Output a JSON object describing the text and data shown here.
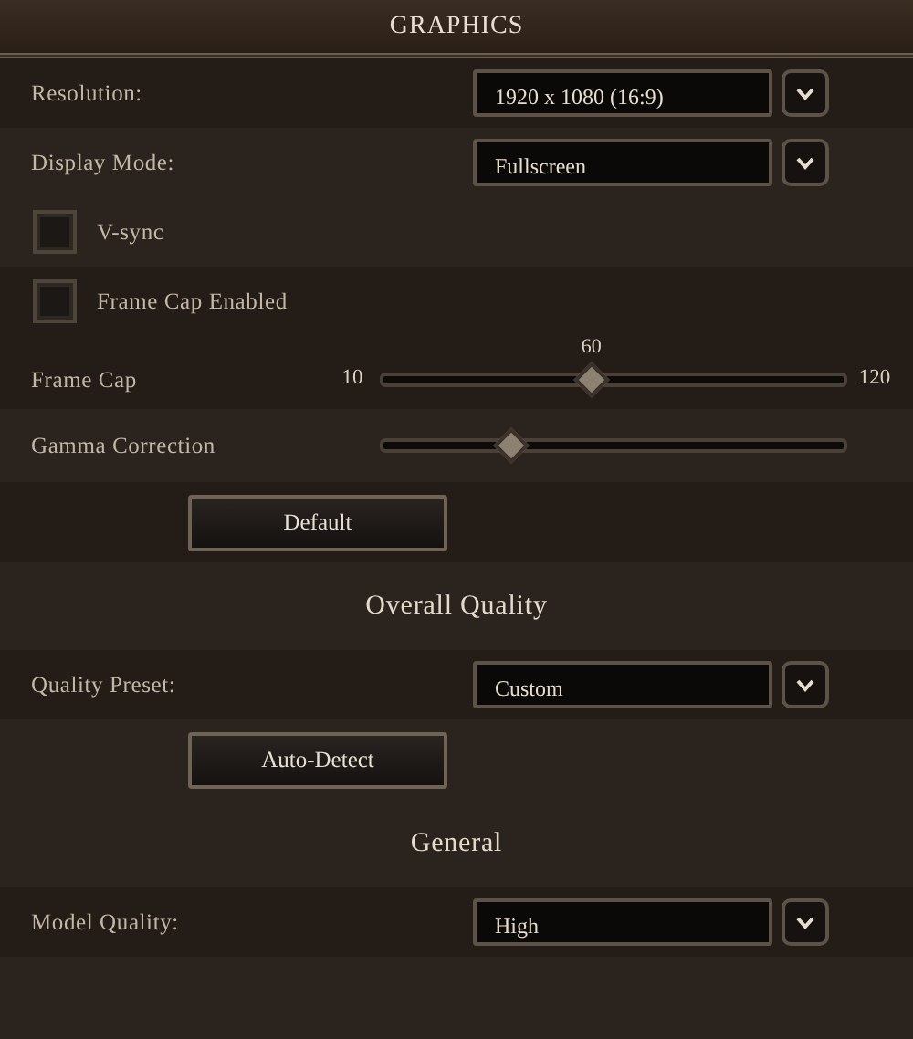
{
  "title": "GRAPHICS",
  "rows": [
    {
      "kind": "dropdown",
      "label": "Resolution:",
      "value": "1920 x 1080 (16:9)"
    },
    {
      "kind": "dropdown",
      "label": "Display Mode:",
      "value": "Fullscreen"
    },
    {
      "kind": "checkbox",
      "label": "V-sync",
      "checked": false
    },
    {
      "kind": "checkbox",
      "label": "Frame Cap Enabled",
      "checked": false
    },
    {
      "kind": "slider",
      "label": "Frame Cap",
      "min": "10",
      "max": "120",
      "reading": "60",
      "level": 0.45
    },
    {
      "kind": "slider",
      "label": "Gamma Correction",
      "level": 0.27
    },
    {
      "kind": "button",
      "label": "Default"
    },
    {
      "kind": "heading",
      "label": "Overall Quality"
    },
    {
      "kind": "dropdown",
      "label": "Quality Preset:",
      "value": "Custom"
    },
    {
      "kind": "button",
      "label": "Auto-Detect"
    },
    {
      "kind": "heading",
      "label": "General"
    },
    {
      "kind": "dropdown",
      "label": "Model Quality:",
      "value": "High"
    }
  ]
}
